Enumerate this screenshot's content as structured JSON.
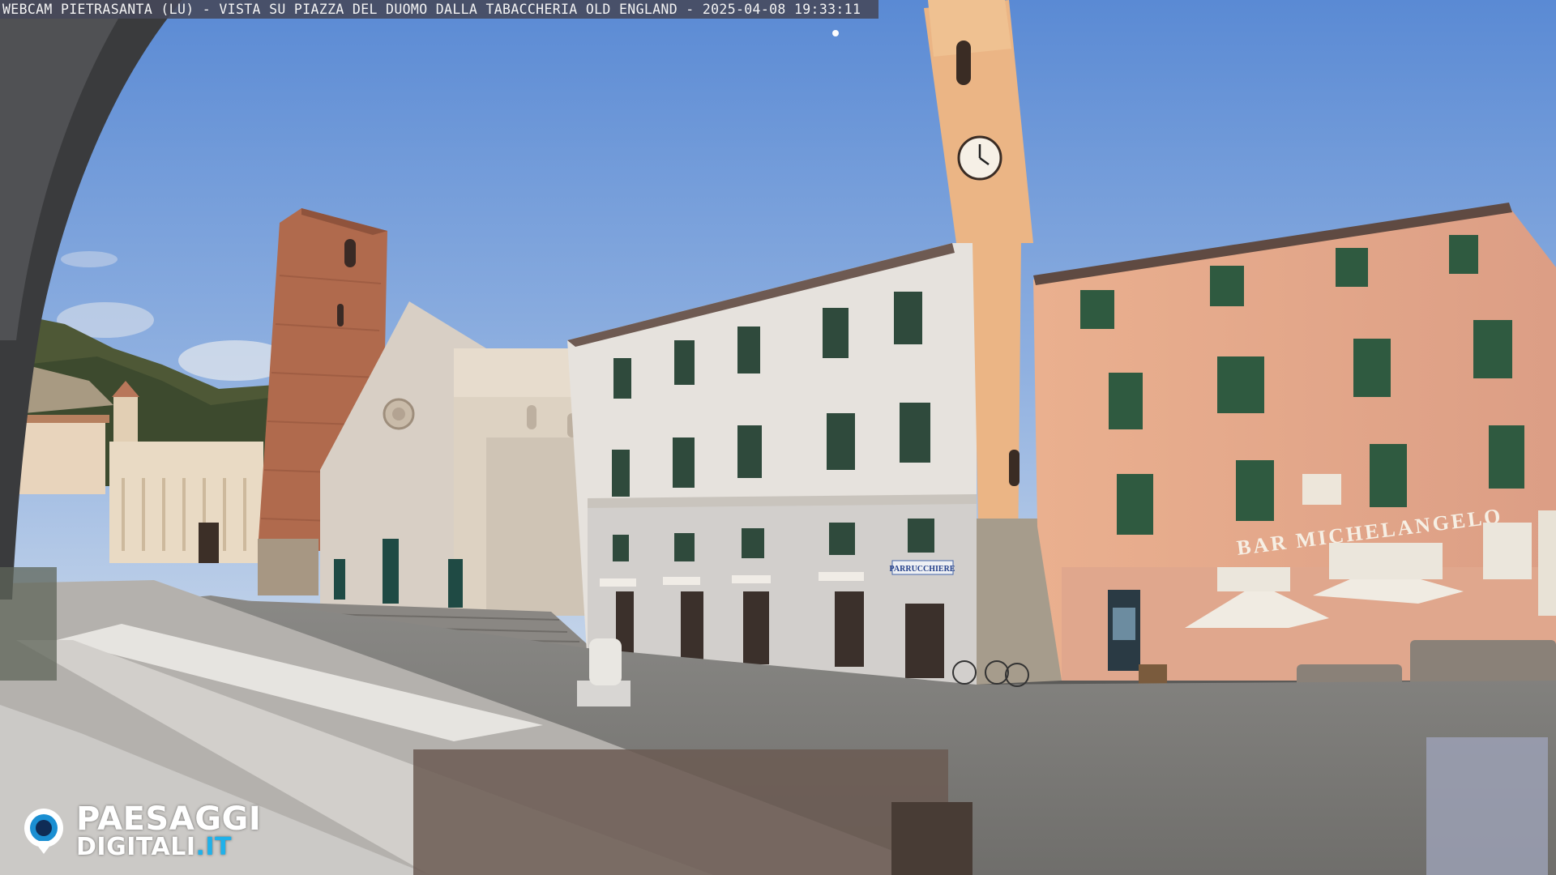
{
  "overlay": {
    "caption": "WEBCAM PIETRASANTA (LU) - VISTA SU PIAZZA DEL DUOMO DALLA TABACCHERIA OLD ENGLAND - 2025-04-08 19:33:11",
    "logo_line1": "PAESAGGI",
    "logo_line2_main": "DIGITALI",
    "logo_line2_tld": ".IT"
  },
  "signs": {
    "bar": "BAR MICHELANGELO",
    "hairdresser": "PARRUCCHIERE"
  },
  "colors": {
    "sky_top": "#5f8fd6",
    "sky_bottom": "#b9cde6",
    "piazza": "#7d7c7a",
    "pink_building": "#e2a58a",
    "white_building": "#e4e0dc",
    "cathedral": "#d9d0c6",
    "brick_tower": "#b76a4c",
    "clock_tower": "#eab686",
    "shutters": "#2f5a40",
    "logo_accent": "#1fb1ea"
  }
}
